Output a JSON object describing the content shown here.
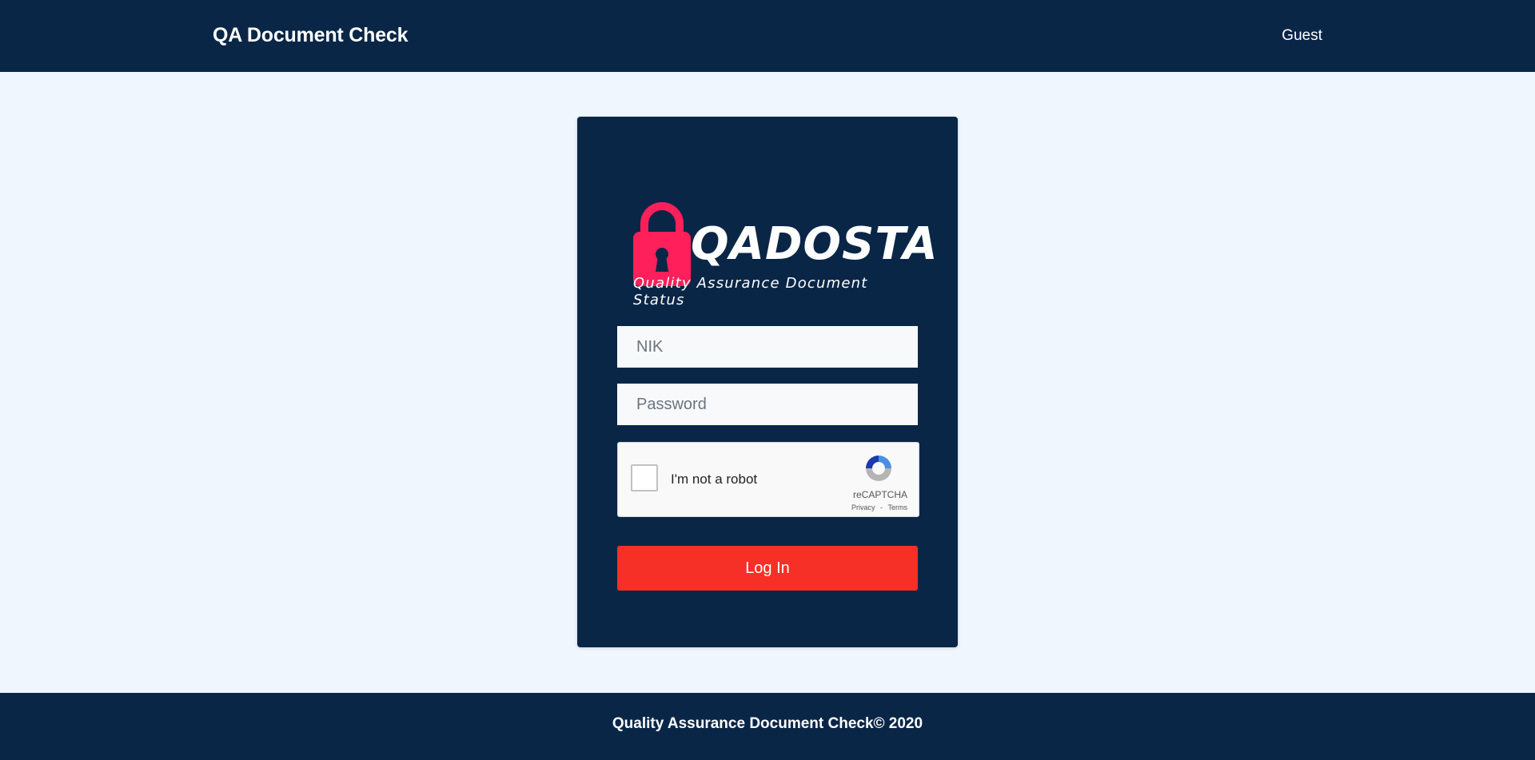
{
  "header": {
    "brand": "QA Document Check",
    "user": "Guest"
  },
  "login": {
    "logo_text": "QADOSTA",
    "logo_tagline": "Quality Assurance Document Status",
    "nik_placeholder": "NIK",
    "password_placeholder": "Password",
    "captcha": {
      "label": "I'm not a robot",
      "brand": "reCAPTCHA",
      "privacy": "Privacy",
      "separator": "-",
      "terms": "Terms"
    },
    "login_button": "Log In",
    "logo_icons": [
      "lock-icon",
      "leaf-icon"
    ],
    "colors": {
      "navy": "#0a2647",
      "accent_red": "#f63026",
      "lock_pink": "#ff1f5a",
      "leaf_green": "#7dc242"
    }
  },
  "footer": {
    "text": "Quality Assurance Document Check© 2020"
  }
}
